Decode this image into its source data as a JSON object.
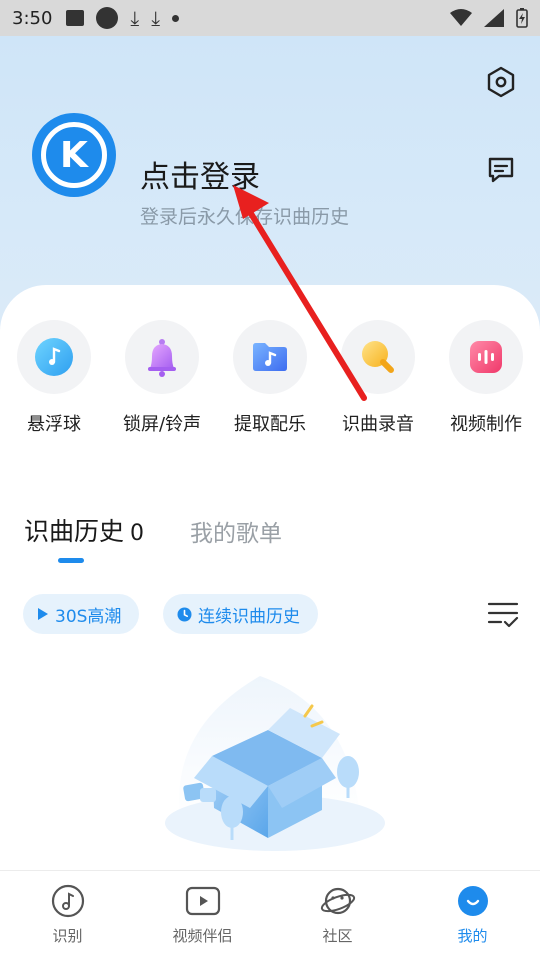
{
  "status_bar": {
    "time": "3:50"
  },
  "header": {
    "login_title": "点击登录",
    "login_subtitle": "登录后永久保存识曲历史",
    "avatar_letter": "K",
    "settings_icon": "hexagon-settings-icon",
    "message_icon": "message-icon"
  },
  "tools": [
    {
      "label": "悬浮球",
      "icon": "floating-ball-icon"
    },
    {
      "label": "锁屏/铃声",
      "icon": "bell-icon"
    },
    {
      "label": "提取配乐",
      "icon": "folder-music-icon"
    },
    {
      "label": "识曲录音",
      "icon": "bulb-icon"
    },
    {
      "label": "视频制作",
      "icon": "video-make-icon"
    }
  ],
  "tabs": {
    "active_label": "识曲历史",
    "active_count": "0",
    "inactive_label": "我的歌单"
  },
  "chips": {
    "chip1": "30S高潮",
    "chip2": "连续识曲历史"
  },
  "bottom_nav": [
    {
      "label": "识别",
      "active": false
    },
    {
      "label": "视频伴侣",
      "active": false
    },
    {
      "label": "社区",
      "active": false
    },
    {
      "label": "我的",
      "active": true
    }
  ],
  "colors": {
    "accent": "#1e8bec",
    "arrow": "#e8201f",
    "hero_bg": "#d3e7f9"
  }
}
